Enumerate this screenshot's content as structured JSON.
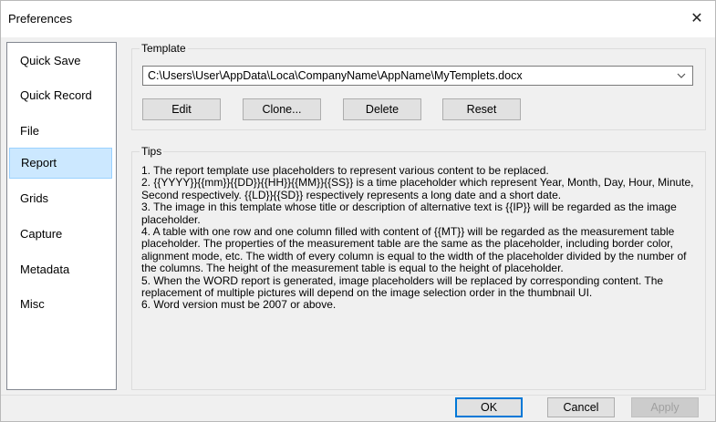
{
  "window": {
    "title": "Preferences"
  },
  "sidebar": {
    "items": [
      {
        "label": "Quick Save"
      },
      {
        "label": "Quick Record"
      },
      {
        "label": "File"
      },
      {
        "label": "Report"
      },
      {
        "label": "Grids"
      },
      {
        "label": "Capture"
      },
      {
        "label": "Metadata"
      },
      {
        "label": "Misc"
      }
    ],
    "selected": "Report"
  },
  "template": {
    "group_label": "Template",
    "path_value": "C:\\Users\\User\\AppData\\Loca\\CompanyName\\AppName\\MyTemplets.docx",
    "buttons": {
      "edit": "Edit",
      "clone": "Clone...",
      "delete": "Delete",
      "reset": "Reset"
    }
  },
  "tips": {
    "group_label": "Tips",
    "text": "1. The report template use placeholders to represent various content to be replaced.\n2. {{YYYY}}{{mm}}{{DD}}{{HH}}{{MM}}{{SS}} is a time placeholder which represent Year, Month, Day, Hour, Minute, Second respectively. {{LD}}{{SD}} respectively represents a long date and a short date.\n3. The image in this template whose title or description of alternative text is {{IP}} will be regarded as the image placeholder.\n4. A table with one row and one column filled with content of {{MT}} will be regarded as the measurement table placeholder. The properties of the measurement table are the same as the placeholder, including border color, alignment mode, etc. The width of every column is equal to the width of the placeholder divided by the number of the columns. The height of the measurement table is equal to the height of placeholder.\n5. When the WORD report is generated, image placeholders will be replaced by corresponding content. The replacement of multiple pictures will depend on the image selection order in the thumbnail UI.\n6. Word version must be 2007 or above."
  },
  "footer": {
    "ok": "OK",
    "cancel": "Cancel",
    "apply": "Apply"
  }
}
